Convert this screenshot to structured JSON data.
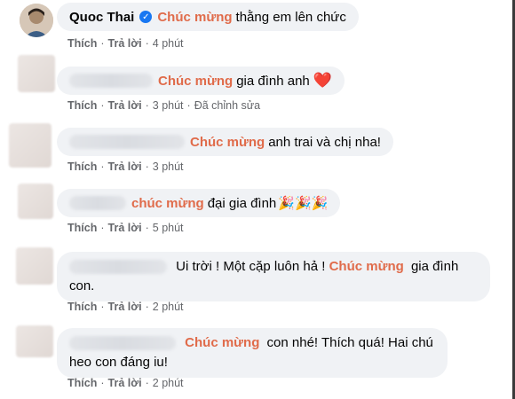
{
  "comments": [
    {
      "author": "Quoc Thai",
      "verified": true,
      "tag": "Chúc mừng",
      "text": "thằng em lên chức",
      "emoji": "",
      "actions": {
        "like": "Thích",
        "reply": "Trả lời",
        "time": "4 phút",
        "edited": ""
      }
    },
    {
      "tag": "Chúc mừng",
      "text": "gia đình anh",
      "emoji": "❤️",
      "actions": {
        "like": "Thích",
        "reply": "Trả lời",
        "time": "3 phút",
        "edited": "Đã chỉnh sửa"
      }
    },
    {
      "tag": "Chúc mừng",
      "text": "anh trai và chị nha!",
      "actions": {
        "like": "Thích",
        "reply": "Trả lời",
        "time": "3 phút"
      }
    },
    {
      "tag": "chúc mừng",
      "text": "đại gia đình",
      "emoji": "🎉🎉🎉",
      "actions": {
        "like": "Thích",
        "reply": "Trả lời",
        "time": "5 phút"
      }
    },
    {
      "pre_text": "Ui trời ! Một cặp luôn hả !",
      "tag": "Chúc mừng",
      "text": "gia đình con.",
      "actions": {
        "like": "Thích",
        "reply": "Trả lời",
        "time": "2 phút"
      }
    },
    {
      "tag": "Chúc mừng",
      "text": "con nhé! Thích quá! Hai chú heo con đáng iu!",
      "actions": {
        "like": "Thích",
        "reply": "Trả lời",
        "time": "2 phút"
      }
    }
  ],
  "colors": {
    "tag": "#e06b4a",
    "bubble": "#f0f2f5",
    "meta": "#65676b",
    "verified": "#1877f2"
  }
}
